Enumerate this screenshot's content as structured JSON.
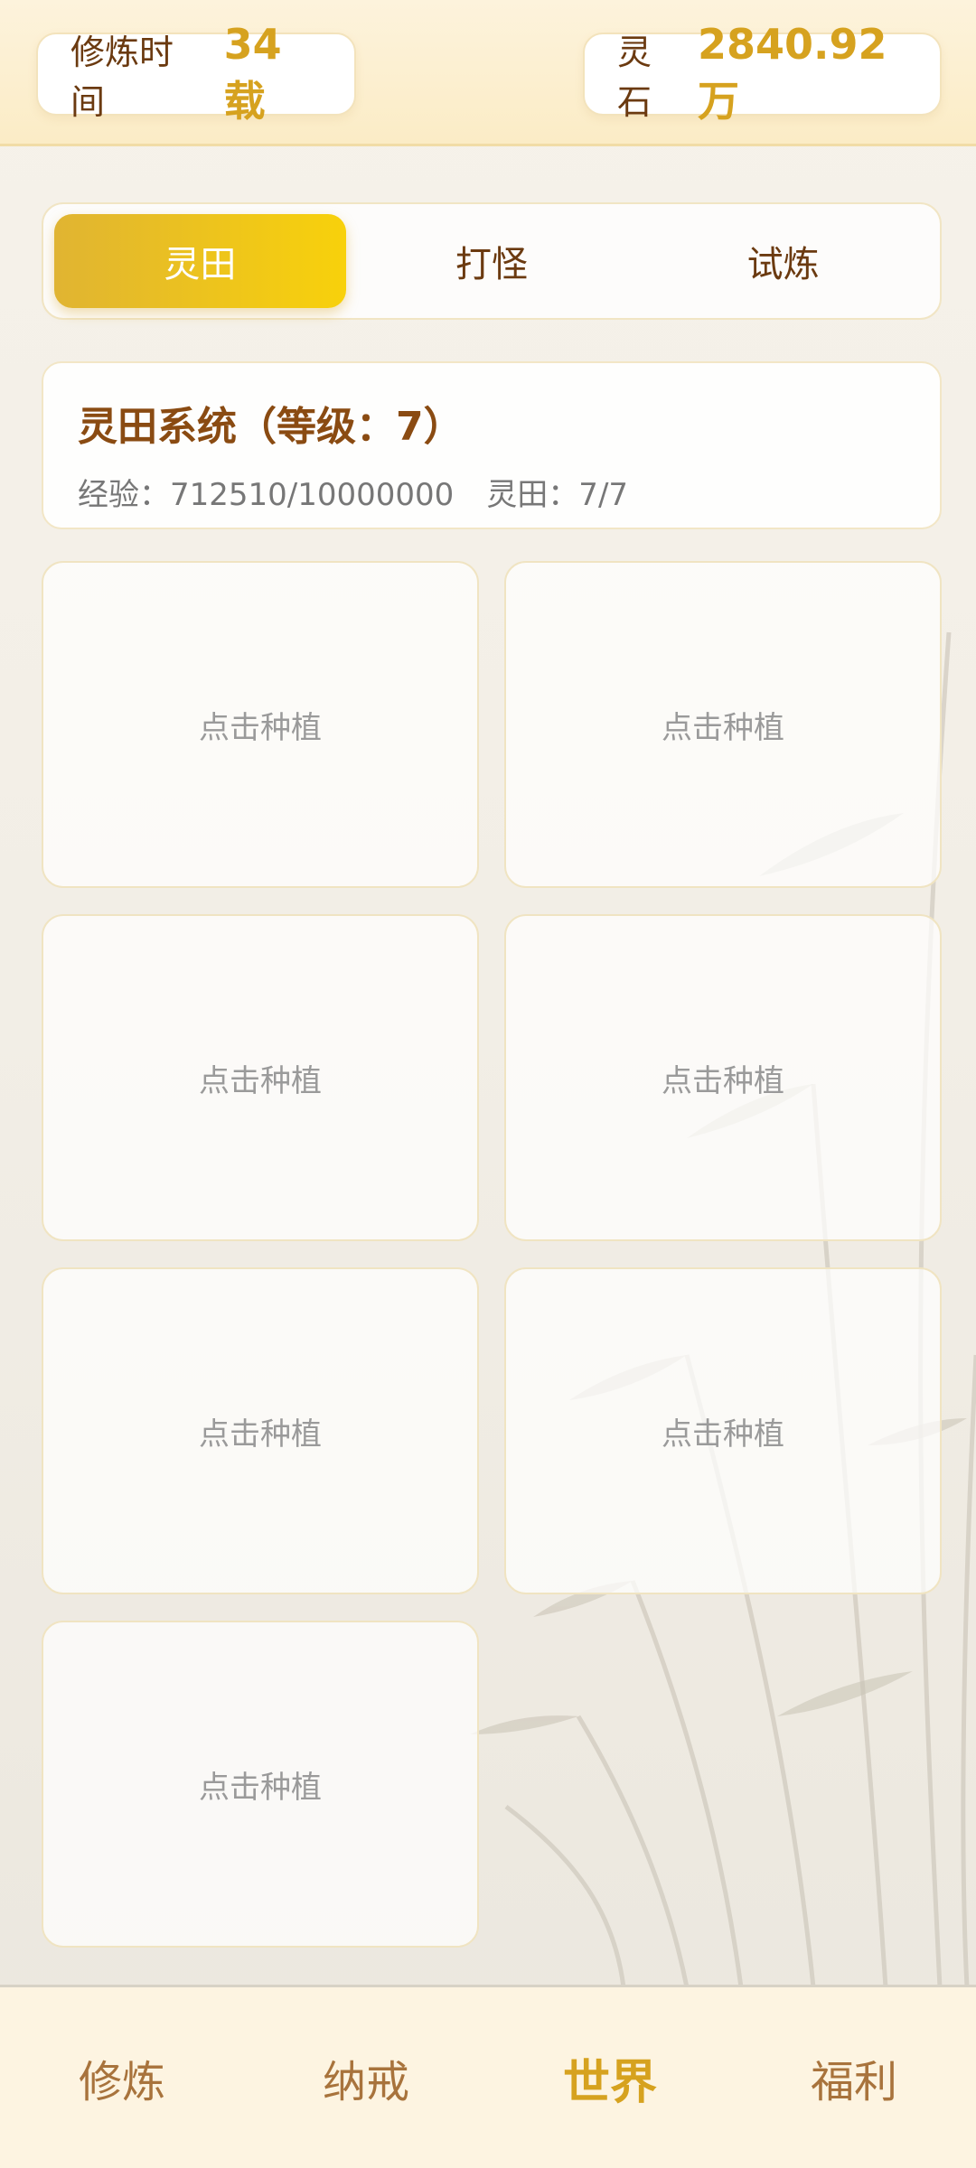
{
  "header": {
    "time_label": "修炼时间",
    "time_value": "34载",
    "stone_label": "灵石",
    "stone_value": "2840.92万"
  },
  "tabs": [
    {
      "label": "灵田",
      "active": true
    },
    {
      "label": "打怪",
      "active": false
    },
    {
      "label": "试炼",
      "active": false
    }
  ],
  "info": {
    "title": "灵田系统（等级：7）",
    "exp": "经验：712510/10000000",
    "fields": "灵田：7/7"
  },
  "plots": [
    {
      "label": "点击种植"
    },
    {
      "label": "点击种植"
    },
    {
      "label": "点击种植"
    },
    {
      "label": "点击种植"
    },
    {
      "label": "点击种植"
    },
    {
      "label": "点击种植"
    },
    {
      "label": "点击种植"
    }
  ],
  "nav": [
    {
      "label": "修炼",
      "active": false
    },
    {
      "label": "纳戒",
      "active": false
    },
    {
      "label": "世界",
      "active": true
    },
    {
      "label": "福利",
      "active": false
    }
  ],
  "colors": {
    "accent": "#d6a21f",
    "text_brown": "#6b3a10",
    "tab_active_start": "#e0b432",
    "tab_active_end": "#f8d10b"
  }
}
